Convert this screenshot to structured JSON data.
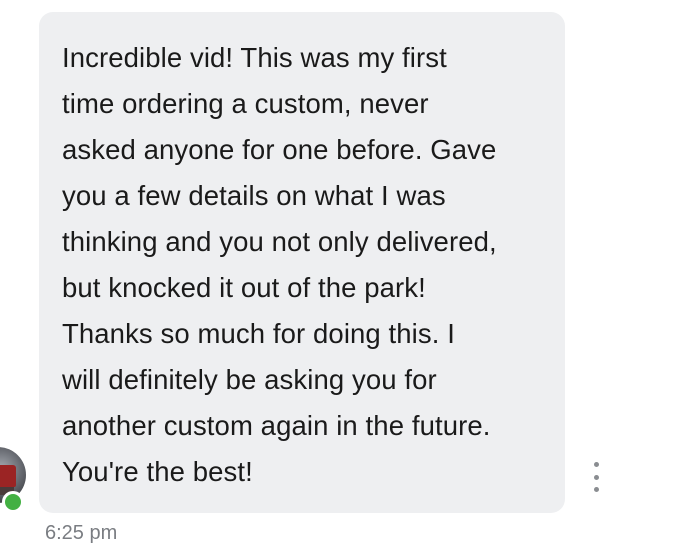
{
  "message": {
    "lines": [
      "Incredible vid! This was my first",
      "time ordering a custom, never",
      "asked anyone for one before. Gave",
      "you a few details on what I was",
      "thinking and you not only delivered,",
      "but knocked it out of the park!",
      "Thanks so much for doing this. I",
      "will definitely be asking you for",
      "another custom again in the future.",
      "You're the best!"
    ],
    "timestamp": "6:25 pm"
  },
  "sender": {
    "avatar_icon": "profile-avatar-icon",
    "status_icon": "online-status-icon",
    "status_color": "#43b043"
  },
  "actions": {
    "more_icon": "more-vertical-icon"
  },
  "colors": {
    "bubble_background": "#eeeff1",
    "text": "#1a1a1a",
    "timestamp": "#7a7d82"
  }
}
